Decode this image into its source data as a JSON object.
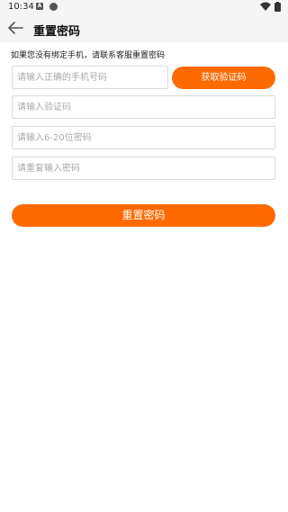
{
  "status_bar": {
    "time": "10:34",
    "notification_letter": "A"
  },
  "header": {
    "title": "重置密码"
  },
  "form": {
    "hint": "如果您没有绑定手机，请联系客服重置密码",
    "phone_placeholder": "请输入正确的手机号码",
    "get_code_label": "获取验证码",
    "code_placeholder": "请输入验证码",
    "password_placeholder": "请输入6-20位密码",
    "confirm_placeholder": "请重复输入密码",
    "submit_label": "重置密码"
  },
  "colors": {
    "accent": "#ff6a00",
    "bar_background": "#f5f5f5"
  },
  "icons": [
    "back-arrow-icon",
    "wifi-icon",
    "battery-icon"
  ]
}
